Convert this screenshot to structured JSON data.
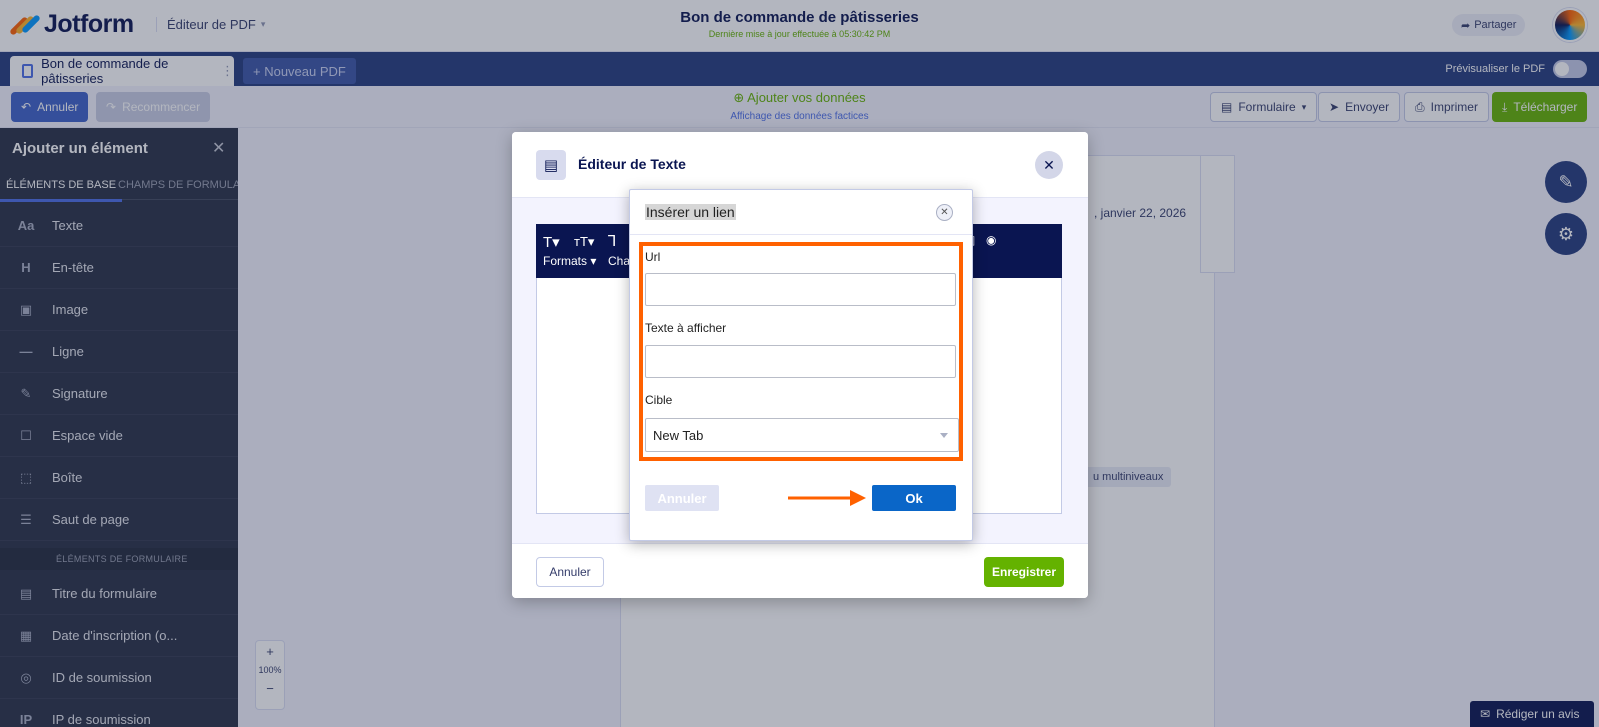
{
  "app": {
    "brand": "Jotform",
    "editor_mode": "Éditeur de PDF",
    "doc_title": "Bon de commande de pâtisseries",
    "doc_subtitle": "Dernière mise à jour effectuée à 05:30:42 PM",
    "share_label": "Partager"
  },
  "tabs": {
    "active_tab": "Bon de commande de pâtisseries",
    "new_pdf": "+ Nouveau PDF",
    "preview_label": "Prévisualiser le PDF"
  },
  "toolbar": {
    "undo": "Annuler",
    "redo": "Recommencer",
    "add_data": "Ajouter vos données",
    "add_data_sub": "Affichage des données factices",
    "form": "Formulaire",
    "send": "Envoyer",
    "print": "Imprimer",
    "download": "Télécharger"
  },
  "sidebar": {
    "title": "Ajouter un élément",
    "tab_basic": "ÉLÉMENTS DE BASE",
    "tab_fields": "CHAMPS DE FORMULA",
    "items": [
      {
        "icon": "Aa",
        "label": "Texte"
      },
      {
        "icon": "H",
        "label": "En-tête"
      },
      {
        "icon": "▣",
        "label": "Image"
      },
      {
        "icon": "—",
        "label": "Ligne"
      },
      {
        "icon": "✎",
        "label": "Signature"
      },
      {
        "icon": "☐",
        "label": "Espace vide"
      },
      {
        "icon": "⬚",
        "label": "Boîte"
      },
      {
        "icon": "☰",
        "label": "Saut de page"
      }
    ],
    "section_form": "ÉLÉMENTS DE FORMULAIRE",
    "form_items": [
      {
        "icon": "▤",
        "label": "Titre du formulaire"
      },
      {
        "icon": "▦",
        "label": "Date d'inscription (o..."
      },
      {
        "icon": "◎",
        "label": "ID de soumission"
      },
      {
        "icon": "IP",
        "label": "IP de soumission"
      }
    ]
  },
  "canvas": {
    "date_text": ", janvier 22, 2026",
    "tag_text": "u multiniveaux",
    "zoom": "100%",
    "zoom_in": "+",
    "zoom_out": "−",
    "review_label": "Rédiger un avis"
  },
  "text_editor": {
    "title": "Éditeur de Texte",
    "formats": "Formats ▾",
    "cha": "Cha",
    "cancel": "Annuler",
    "save": "Enregistrer"
  },
  "link_dialog": {
    "title": "Insérer un lien",
    "url_label": "Url",
    "url_value": "",
    "text_label": "Texte à afficher",
    "text_value": "",
    "target_label": "Cible",
    "target_value": "New Tab",
    "cancel": "Annuler",
    "ok": "Ok"
  },
  "colors": {
    "highlight": "#ff6100",
    "ok_button": "#0a66c8",
    "save_button": "#64b200",
    "sidebar_bg": "#293146",
    "navy": "#0a1551"
  },
  "icons": {
    "close": "×",
    "share": "share-arrow-icon",
    "undo": "undo-icon",
    "redo": "redo-icon"
  }
}
